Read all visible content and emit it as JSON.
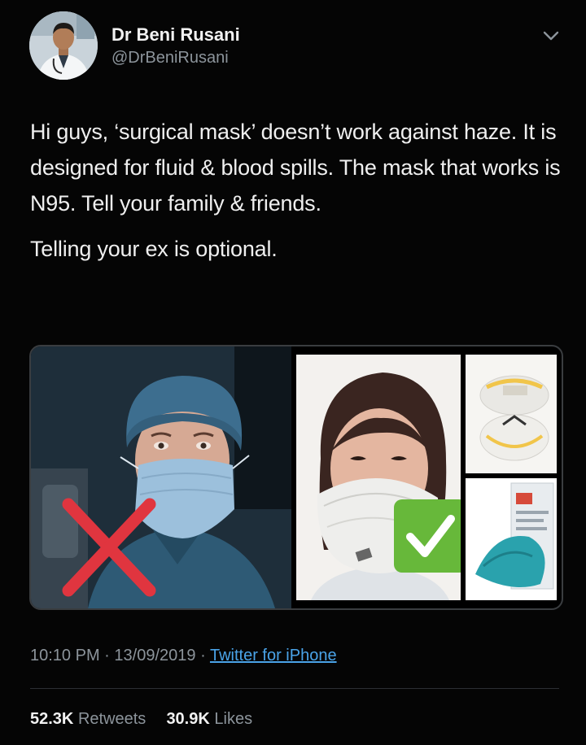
{
  "author": {
    "name": "Dr Beni Rusani",
    "handle": "@DrBeniRusani"
  },
  "tweet": {
    "paragraph1": "Hi guys, ‘surgical mask’ doesn’t work against haze. It is designed for fluid & blood spills. The mask that works is N95. Tell your family & friends.",
    "paragraph2": "Telling your ex is optional."
  },
  "meta": {
    "time": "10:10 PM",
    "separator": "·",
    "date": "13/09/2019",
    "source": "Twitter for iPhone"
  },
  "stats": {
    "retweets_count": "52.3K",
    "retweets_label": "Retweets",
    "likes_count": "30.9K",
    "likes_label": "Likes"
  },
  "icons": {
    "menu": "chevron-down-icon",
    "wrong": "red-x-icon",
    "right": "green-check-icon"
  },
  "colors": {
    "background": "#050505",
    "link": "#4aa3e8",
    "muted": "#8c949b",
    "wrong": "#e0353f",
    "right": "#67b83a"
  }
}
